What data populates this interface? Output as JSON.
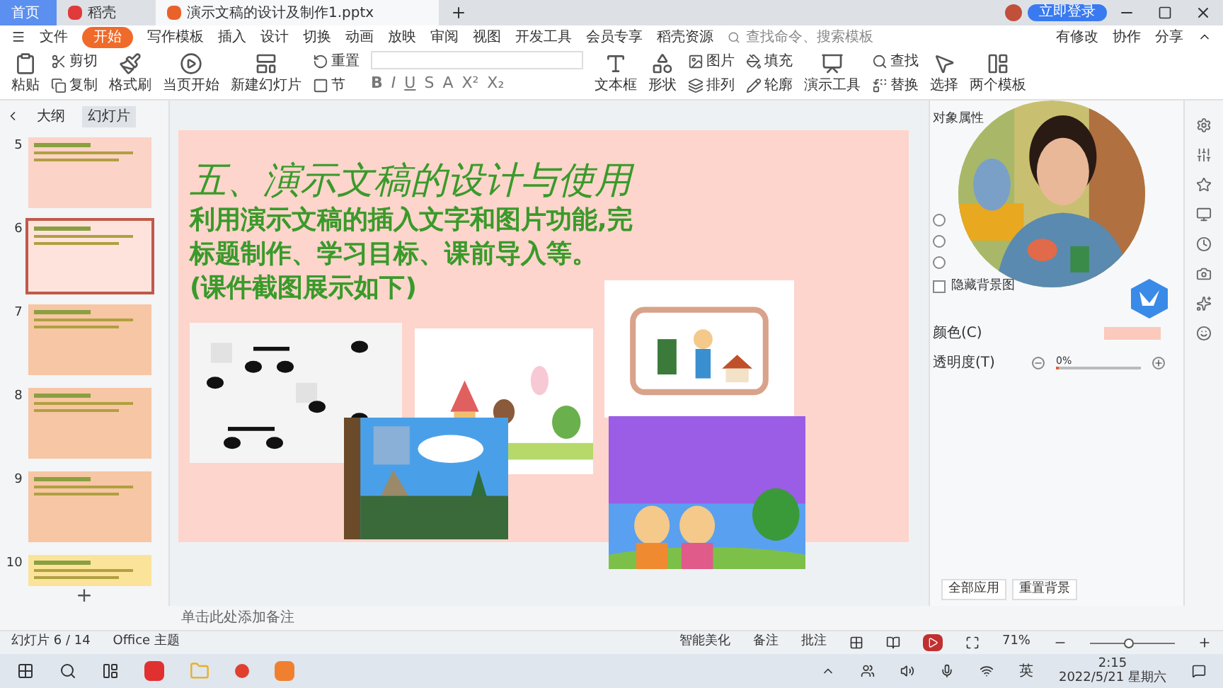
{
  "title_bar": {
    "tabs": [
      {
        "label": "首页",
        "selected": false
      },
      {
        "label": "稻壳",
        "selected": false
      },
      {
        "label": "演示文稿的设计及制作1.pptx",
        "selected": true
      }
    ],
    "login": "立即登录"
  },
  "menu": {
    "file": "文件",
    "items": [
      {
        "label": "开始",
        "selected": true
      },
      {
        "label": "写作模板",
        "selected": false
      },
      {
        "label": "插入",
        "selected": false
      },
      {
        "label": "设计",
        "selected": false
      },
      {
        "label": "切换",
        "selected": false
      },
      {
        "label": "动画",
        "selected": false
      },
      {
        "label": "放映",
        "selected": false
      },
      {
        "label": "审阅",
        "selected": false
      },
      {
        "label": "视图",
        "selected": false
      },
      {
        "label": "开发工具",
        "selected": false
      },
      {
        "label": "会员专享",
        "selected": false
      },
      {
        "label": "稻壳资源",
        "selected": false
      }
    ],
    "search": {
      "placeholder": "查找命令、搜索模板"
    },
    "actions": [
      "有修改",
      "协作",
      "分享"
    ]
  },
  "ribbon": {
    "items": [
      {
        "kind": "big",
        "label": "粘贴"
      },
      {
        "kind": "stack",
        "labels": [
          "剪切",
          "复制"
        ]
      },
      {
        "kind": "big",
        "label": "格式刷"
      },
      {
        "kind": "big",
        "label": "当页开始"
      },
      {
        "kind": "big",
        "label": "新建幻灯片"
      },
      {
        "kind": "stack",
        "labels": [
          "重置",
          "节"
        ]
      },
      {
        "kind": "format",
        "buttons": [
          "B",
          "I",
          "U",
          "S",
          "A",
          "X²",
          "X₂"
        ]
      },
      {
        "kind": "big",
        "label": "文本框"
      },
      {
        "kind": "big",
        "label": "形状"
      },
      {
        "kind": "stack",
        "labels": [
          "图片",
          "排列"
        ]
      },
      {
        "kind": "stack",
        "labels": [
          "填充",
          "轮廓"
        ]
      },
      {
        "kind": "big",
        "label": "演示工具"
      },
      {
        "kind": "stack",
        "labels": [
          "查找",
          "替换"
        ]
      },
      {
        "kind": "big",
        "label": "选择"
      },
      {
        "kind": "big",
        "label": "两个模板"
      }
    ]
  },
  "left_panel": {
    "tabs": [
      {
        "label": "大纲",
        "selected": false
      },
      {
        "label": "幻灯片",
        "selected": true
      }
    ],
    "slides": [
      {
        "number": "5",
        "selected": false,
        "color": "#fbd3c7"
      },
      {
        "number": "6",
        "selected": true,
        "color": "#fde3dc"
      },
      {
        "number": "7",
        "selected": false,
        "color": "#f7c6a4"
      },
      {
        "number": "8",
        "selected": false,
        "color": "#f7c6a4"
      },
      {
        "number": "9",
        "selected": false,
        "color": "#f7c6a4"
      },
      {
        "number": "10",
        "selected": false,
        "color": "#fbe49a"
      }
    ],
    "add": "+"
  },
  "slide": {
    "title": "五、演示文稿的设计与使用",
    "body": [
      "利用演示文稿的插入文字和图片功能,完",
      "标题制作、学习目标、课前导入等。",
      "(课件截图展示如下)"
    ]
  },
  "notes": {
    "placeholder": "单击此处添加备注"
  },
  "right_panel": {
    "title": "对象属性",
    "radios": [
      {
        "selected": false
      },
      {
        "selected": false
      },
      {
        "selected": false
      }
    ],
    "hide_graphics": {
      "label": "隐藏背景图",
      "checked": false
    },
    "color_label": "颜色(C)",
    "color": "#fcc9bd",
    "transparency": {
      "label": "透明度(T)",
      "reading": "0%",
      "level": 0
    },
    "buttons": [
      "全部应用",
      "重置背景"
    ]
  },
  "status_bar": {
    "slide_count": "幻灯片 6 / 14",
    "theme": "Office 主题",
    "beautify": "智能美化",
    "notes": "备注",
    "comments": "批注",
    "zoom": "71%",
    "level": 0.45
  },
  "taskbar": {
    "ime": "英",
    "time": "2:15",
    "date": "2022/5/21 星期六"
  }
}
